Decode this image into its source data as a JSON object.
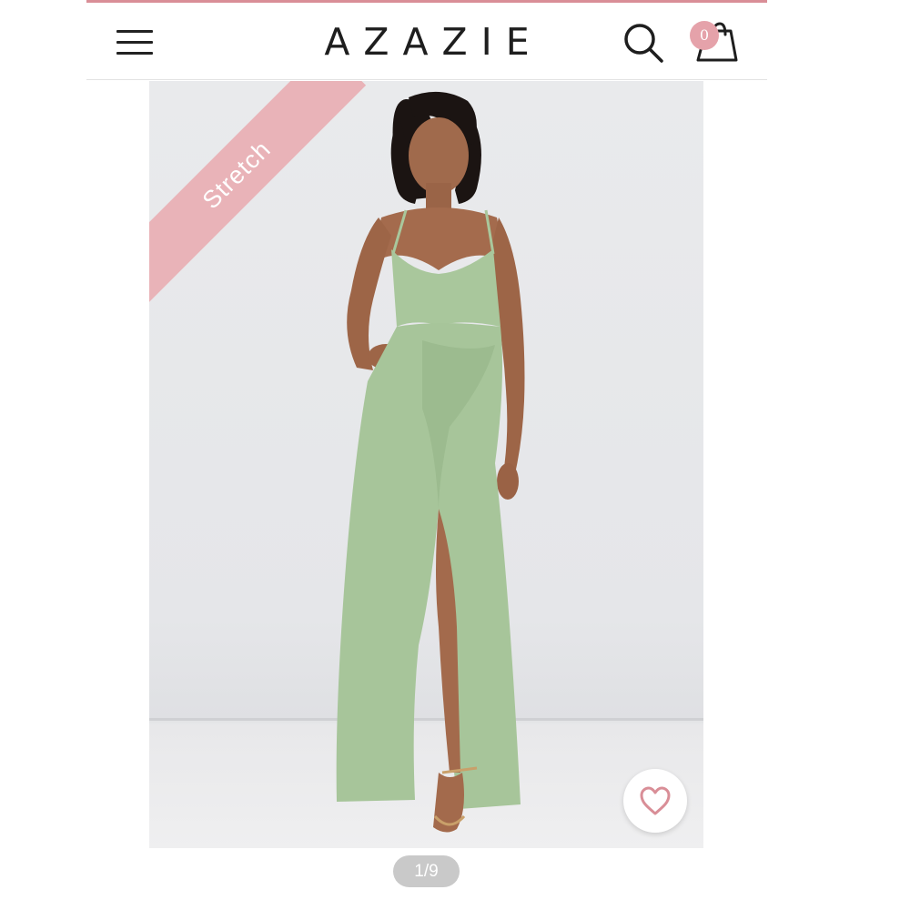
{
  "header": {
    "brand": "AZAZIE",
    "cart_count": "0",
    "menu_icon": "hamburger-menu-icon",
    "search_icon": "search-icon",
    "cart_icon": "shopping-bag-icon"
  },
  "product": {
    "badge": "Stretch",
    "image_description_colors": {
      "dress": "#a9c79c",
      "background": "#e7e8ea",
      "badge": "#e9b3b8"
    },
    "wishlist_icon": "heart-icon",
    "gallery_position": "1/9"
  },
  "colors": {
    "accent": "#d98e97",
    "cart_badge": "#e5a2aa"
  }
}
